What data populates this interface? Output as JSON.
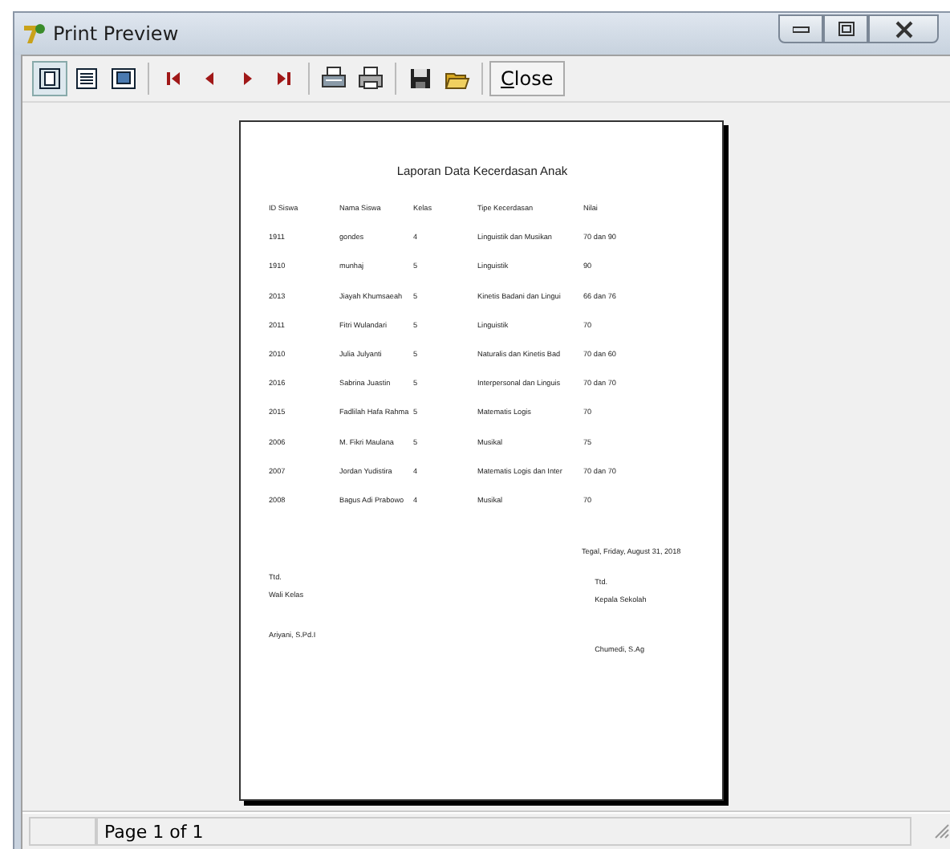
{
  "window": {
    "title": "Print Preview"
  },
  "toolbar": [
    {
      "kind": "one-page",
      "selected": true
    },
    {
      "kind": "multi-page",
      "selected": false
    },
    {
      "kind": "fit",
      "selected": false
    },
    {
      "kind": "sep"
    },
    {
      "kind": "first"
    },
    {
      "kind": "prev"
    },
    {
      "kind": "next"
    },
    {
      "kind": "last"
    },
    {
      "kind": "sep"
    },
    {
      "kind": "print-setup"
    },
    {
      "kind": "print"
    },
    {
      "kind": "sep"
    },
    {
      "kind": "save"
    },
    {
      "kind": "open"
    },
    {
      "kind": "sep"
    },
    {
      "kind": "text",
      "label": "Close"
    }
  ],
  "report": {
    "title": "Laporan Data Kecerdasan Anak",
    "columns": [
      "ID Siswa",
      "Nama Siswa",
      "Kelas",
      "Tipe Kecerdasan",
      "Nilai"
    ],
    "rows": [
      [
        "1911",
        "gondes",
        "4",
        "Linguistik dan Musikan",
        "70 dan 90"
      ],
      [
        "1910",
        "munhaj",
        "5",
        "Linguistik",
        "90"
      ],
      [
        "2013",
        "Jiayah Khumsaeah",
        "5",
        "Kinetis Badani dan Lingui",
        "66 dan 76"
      ],
      [
        "2011",
        "Fitri Wulandari",
        "5",
        "Linguistik",
        "70"
      ],
      [
        "2010",
        "Julia Julyanti",
        "5",
        "Naturalis dan Kinetis Bad",
        "70 dan 60"
      ],
      [
        "2016",
        "Sabrina Juastin",
        "5",
        "Interpersonal dan Linguis",
        "70 dan 70"
      ],
      [
        "2015",
        "Fadlilah Hafa Rahma",
        "5",
        "Matematis Logis",
        "70"
      ],
      [
        "2006",
        "M. Fikri Maulana",
        "5",
        "Musikal",
        "75"
      ],
      [
        "2007",
        "Jordan Yudistira",
        "4",
        "Matematis Logis dan Inter",
        "70 dan 70"
      ],
      [
        "2008",
        "Bagus Adi Prabowo",
        "4",
        "Musikal",
        "70"
      ]
    ],
    "date_line": "Tegal,   Friday, August 31, 2018",
    "left_sign": {
      "ttd": "Ttd.",
      "role": "Wali Kelas",
      "name": "Ariyani, S.Pd.I"
    },
    "right_sign": {
      "ttd": "Ttd.",
      "role": "Kepala Sekolah",
      "name": "Chumedi, S.Ag"
    }
  },
  "status_bar": {
    "page": "Page 1 of 1"
  }
}
